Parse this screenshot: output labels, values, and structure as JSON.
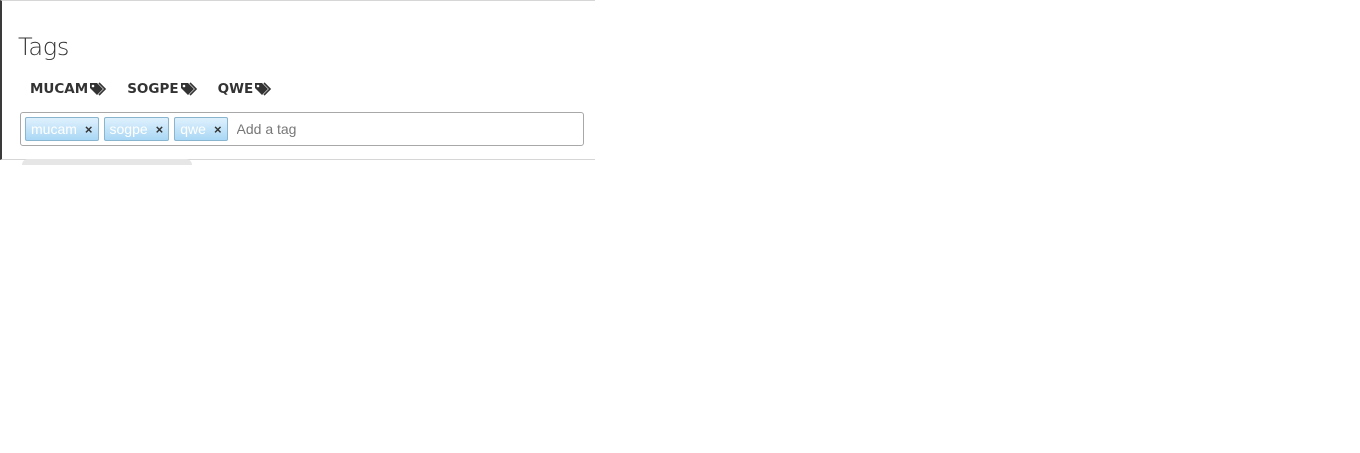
{
  "section": {
    "title": "Tags"
  },
  "tag_links": [
    {
      "label": "MUCAM",
      "icon": "tags-icon"
    },
    {
      "label": "SOGPE",
      "icon": "tags-icon"
    },
    {
      "label": "QWE",
      "icon": "tags-icon"
    }
  ],
  "tag_input": {
    "chips": [
      {
        "label": "mucam",
        "remove": "×"
      },
      {
        "label": "sogpe",
        "remove": "×"
      },
      {
        "label": "qwe",
        "remove": "×"
      }
    ],
    "placeholder": "Add a tag",
    "value": ""
  },
  "colors": {
    "chip_gradient_top": "#dff1fd",
    "chip_gradient_bottom": "#a9d7f5",
    "chip_border": "#8ab5cf"
  }
}
